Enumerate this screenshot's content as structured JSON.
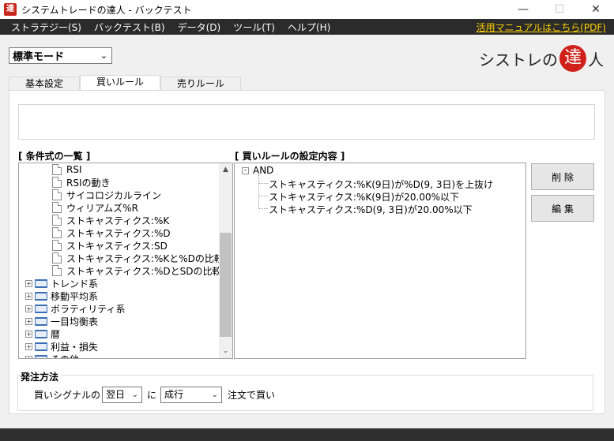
{
  "window": {
    "title": "システムトレードの達人 - バックテスト",
    "icon_char": "達"
  },
  "menu": {
    "items": [
      "ストラテジー(S)",
      "バックテスト(B)",
      "データ(D)",
      "ツール(T)",
      "ヘルプ(H)"
    ],
    "manual_link": "活用マニュアルはこちら(PDF)"
  },
  "mode": {
    "selected": "標準モード"
  },
  "logo": {
    "pre": "シストレの",
    "seal": "達",
    "post": "人"
  },
  "tabs": [
    "基本設定",
    "買いルール",
    "売りルール"
  ],
  "active_tab": 1,
  "conditions": {
    "label": "[ 条件式の一覧 ]",
    "leaf_items": [
      "RSI",
      "RSIの動き",
      "サイコロジカルライン",
      "ウィリアムズ%R",
      "ストキャスティクス:%K",
      "ストキャスティクス:%D",
      "ストキャスティクス:SD",
      "ストキャスティクス:%Kと%Dの比較",
      "ストキャスティクス:%DとSDの比較"
    ],
    "folders": [
      "トレンド系",
      "移動平均系",
      "ボラティリティ系",
      "一目均衡表",
      "暦",
      "利益・損失",
      "その他"
    ]
  },
  "rules": {
    "label": "[ 買いルールの設定内容 ]",
    "root": "AND",
    "items": [
      "ストキャスティクス:%K(9日)が%D(9, 3日)を上抜け",
      "ストキャスティクス:%K(9日)が20.00%以下",
      "ストキャスティクス:%D(9, 3日)が20.00%以下"
    ]
  },
  "buttons": {
    "delete": "削 除",
    "edit": "編 集"
  },
  "order": {
    "label": "発注方法",
    "prefix": "買いシグナルの",
    "day": "翌日",
    "ni": "に",
    "method": "成行",
    "suffix": "注文で買い"
  }
}
